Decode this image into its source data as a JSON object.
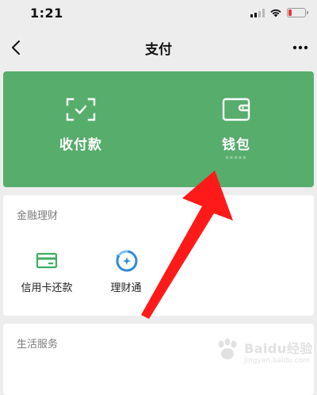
{
  "status_bar": {
    "time": "1:21",
    "icons": [
      "cellular-signal-icon",
      "wifi-icon",
      "battery-icon"
    ],
    "battery_color": "#e53935"
  },
  "nav": {
    "title": "支付",
    "back_icon": "chevron-left-icon",
    "more_icon": "ellipsis-icon"
  },
  "pay_card": {
    "color": "#57ad6c",
    "actions": [
      {
        "label": "收付款",
        "icon": "scan-qr-icon"
      },
      {
        "label": "钱包",
        "sublabel": "*****",
        "icon": "wallet-icon"
      }
    ]
  },
  "finance_section": {
    "title": "金融理财",
    "items": [
      {
        "label": "信用卡还款",
        "icon": "credit-card-icon"
      },
      {
        "label": "理财通",
        "icon": "wealth-management-icon"
      }
    ]
  },
  "life_section": {
    "title": "生活服务"
  },
  "annotation": {
    "arrow_color": "#ff1a1a",
    "icon": "red-arrow-icon"
  },
  "watermark": {
    "text": "Baidu经验",
    "sub": "jingyan.baidu.com"
  }
}
